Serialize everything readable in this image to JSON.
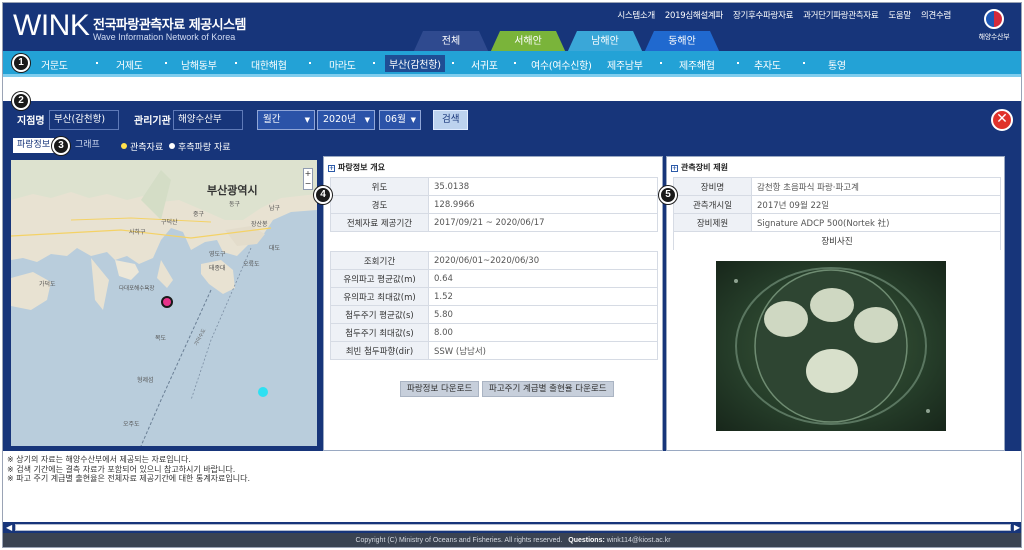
{
  "header": {
    "logo": "WINK",
    "title_ko": "전국파랑관측자료 제공시스템",
    "title_en": "Wave Information Network of Korea",
    "links": [
      "시스템소개",
      "2019심해설계파",
      "장기후수파랑자료",
      "과거단기파랑관측자료",
      "도움말",
      "의견수렴"
    ],
    "emblem_label": "해양수산부"
  },
  "region_tabs": [
    {
      "label": "전체"
    },
    {
      "label": "서해안"
    },
    {
      "label": "남해안"
    },
    {
      "label": "동해안"
    }
  ],
  "stations": [
    "거문도",
    "거제도",
    "남해동부",
    "대한해협",
    "마라도",
    "부산(감천항)",
    "서귀포",
    "여수(여수신항)",
    "제주남부",
    "제주해협",
    "추자도",
    "통영"
  ],
  "markers": [
    "1",
    "2",
    "3",
    "4",
    "5"
  ],
  "search": {
    "station_label": "지점명",
    "station_value": "부산(감천항)",
    "agency_label": "관리기관",
    "agency_value": "해양수산부",
    "period": "월간",
    "year": "2020년",
    "month": "06월",
    "search_label": "검색",
    "close_glyph": "✕"
  },
  "sub_tabs": {
    "info": "파랑정보",
    "graph": "그래프"
  },
  "legend": {
    "obs": "관측자료",
    "hindcast": "후측파랑 자료"
  },
  "map": {
    "city_label": "부산광역시",
    "labels": [
      "구덕산",
      "사하구",
      "중구",
      "영도구",
      "동구",
      "남구",
      "장산봉",
      "대도",
      "가덕도",
      "다대포해수욕장",
      "태종대",
      "오륙도",
      "목도",
      "형제섬",
      "오주도",
      "가덕수도"
    ],
    "zoom_in": "+",
    "zoom_out": "−"
  },
  "overview": {
    "title": "파랑정보 개요",
    "rows": [
      {
        "k": "위도",
        "v": "35.0138"
      },
      {
        "k": "경도",
        "v": "128.9966"
      },
      {
        "k": "전체자료 제공기간",
        "v": "2017/09/21 ~ 2020/06/17"
      }
    ],
    "stats": [
      {
        "k": "조회기간",
        "v": "2020/06/01~2020/06/30"
      },
      {
        "k": "유의파고 평균값(m)",
        "v": "0.64"
      },
      {
        "k": "유의파고 최대값(m)",
        "v": "1.52"
      },
      {
        "k": "첨두주기 평균값(s)",
        "v": "5.80"
      },
      {
        "k": "첨두주기 최대값(s)",
        "v": "8.00"
      },
      {
        "k": "최빈 첨두파향(dir)",
        "v": "SSW (남남서)"
      }
    ],
    "btn_download": "파랑정보 다운로드",
    "btn_period_download": "파고주기 계급별 출현율 다운로드"
  },
  "equipment": {
    "title": "관측장비 제원",
    "rows": [
      {
        "k": "장비명",
        "v": "감천항 초음파식 파랑·파고계"
      },
      {
        "k": "관측개시일",
        "v": "2017년 09월 22일"
      },
      {
        "k": "장비제원",
        "v": "Signature ADCP 500(Nortek 社)"
      }
    ],
    "photo_label": "장비사진"
  },
  "notes": [
    "※ 상기의 자료는 해양수산부에서 제공되는 자료입니다.",
    "※ 검색 기간에는 결측 자료가 포함되어 있으니 참고하시기 바랍니다.",
    "※ 파고 주기 계급별 출현율은 전체자료 제공기간에 대한 통계자료입니다."
  ],
  "scroll": {
    "left": "◀",
    "right": "▶"
  },
  "footer": {
    "copyright": "Copyright (C) Ministry of Oceans and Fisheries. All rights reserved.",
    "questions_label": "Questions:",
    "email": "wink114@kiost.ac.kr"
  }
}
